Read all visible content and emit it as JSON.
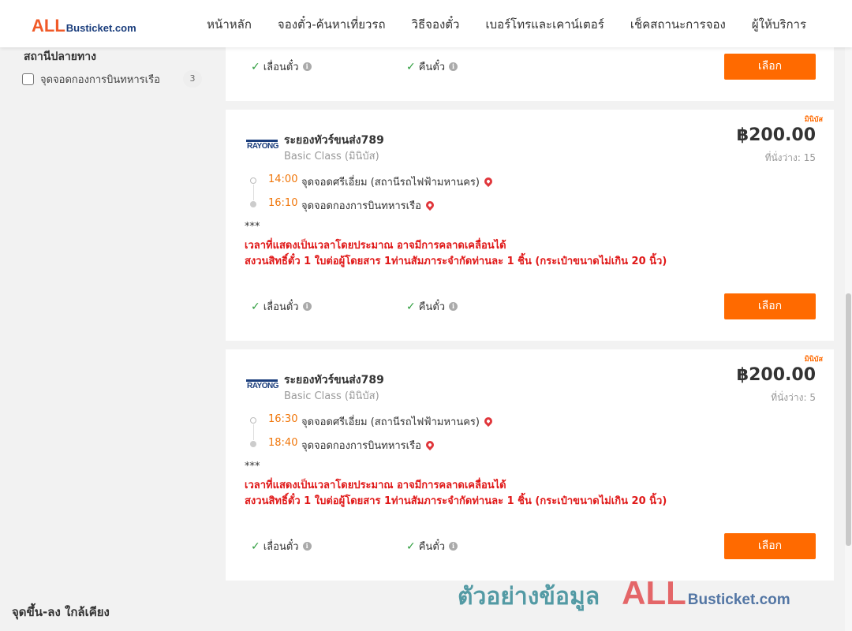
{
  "header": {
    "logo_all": "ALL",
    "logo_site": "Busticket.com",
    "nav": [
      "หน้าหลัก",
      "จองตั๋ว-ค้นหาเที่ยวรถ",
      "วิธีจองตั๋ว",
      "เบอร์โทรและเคาน์เตอร์",
      "เช็คสถานะการจอง",
      "ผู้ให้บริการ"
    ]
  },
  "sidebar": {
    "section_title": "สถานีปลายทาง",
    "filters": [
      {
        "label": "จุดจอดกองการบินทหารเรือ",
        "count": "3",
        "checked": false
      }
    ],
    "nearby_title": "จุดขึ้น-ลง ใกล้เคียง"
  },
  "common": {
    "reschedule_label": "เลื่อนตั๋ว",
    "refund_label": "คืนตั๋ว",
    "select_label": "เลือก",
    "check_glyph": "✓",
    "info_glyph": "i"
  },
  "trips": [
    {
      "tag": "มินิบัส",
      "operator_logo": "RAYONG",
      "operator": "ระยองทัวร์ขนส่ง789",
      "class": "Basic Class (มินิบัส)",
      "price": "฿200.00",
      "seats": "ที่นั่งว่าง: 15",
      "depart_time": "14:00",
      "depart_stop": "จุดจอดศรีเอี่ยม (สถานีรถไฟฟ้ามหานคร)",
      "arrive_time": "16:10",
      "arrive_stop": "จุดจอดกองการบินทหารเรือ",
      "note_stars": "***",
      "note_1": "เวลาที่แสดงเป็นเวลาโดยประมาณ อาจมีการคลาดเคลื่อนได้",
      "note_2": "สงวนสิทธิ์ตั๋ว 1 ใบต่อผู้โดยสาร 1ท่านสัมภาระจำกัดท่านละ 1 ชิ้น (กระเป๋าขนาดไม่เกิน 20 นิ้ว)"
    },
    {
      "tag": "มินิบัส",
      "operator_logo": "RAYONG",
      "operator": "ระยองทัวร์ขนส่ง789",
      "class": "Basic Class (มินิบัส)",
      "price": "฿200.00",
      "seats": "ที่นั่งว่าง: 5",
      "depart_time": "16:30",
      "depart_stop": "จุดจอดศรีเอี่ยม (สถานีรถไฟฟ้ามหานคร)",
      "arrive_time": "18:40",
      "arrive_stop": "จุดจอดกองการบินทหารเรือ",
      "note_stars": "***",
      "note_1": "เวลาที่แสดงเป็นเวลาโดยประมาณ อาจมีการคลาดเคลื่อนได้",
      "note_2": "สงวนสิทธิ์ตั๋ว 1 ใบต่อผู้โดยสาร 1ท่านสัมภาระจำกัดท่านละ 1 ชิ้น (กระเป๋าขนาดไม่เกิน 20 นิ้ว)"
    }
  ],
  "watermark": {
    "text": "ตัวอย่างข้อมูล",
    "all": "ALL",
    "site": "Busticket.com"
  },
  "colors": {
    "accent": "#ff6a00",
    "time": "#f0760a",
    "warning": "#e01818",
    "brand_red": "#f05a28",
    "brand_blue": "#1a3d7c"
  }
}
